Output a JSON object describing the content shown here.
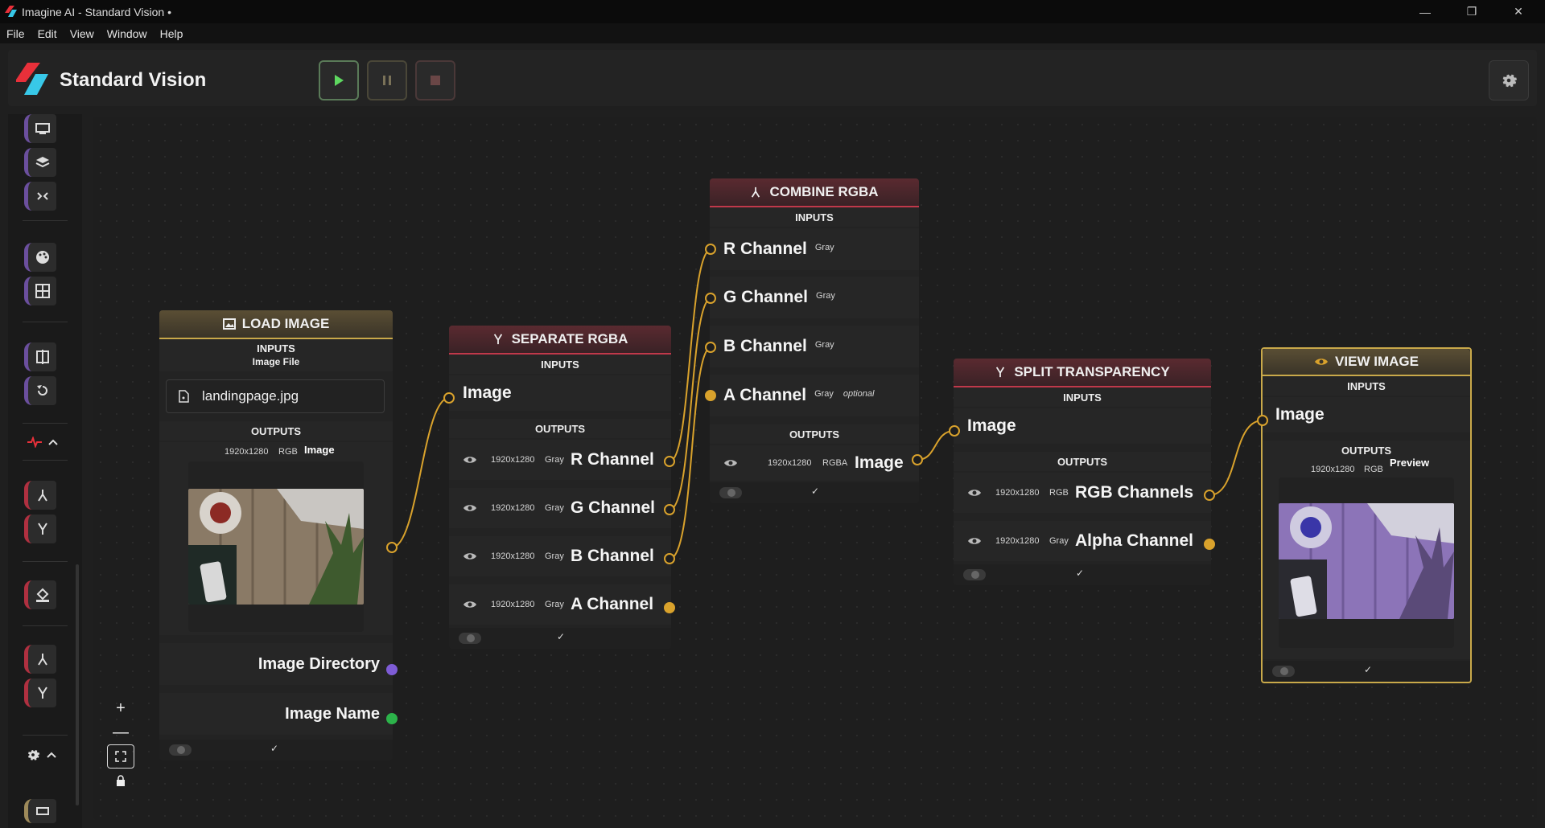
{
  "window": {
    "title": "Imagine AI - Standard Vision •",
    "minimize": "—",
    "restore": "❐",
    "close": "✕"
  },
  "menu": [
    "File",
    "Edit",
    "View",
    "Window",
    "Help"
  ],
  "header": {
    "brand": "Standard Vision"
  },
  "colors": {
    "gold": "#c9a94a",
    "red": "#c0384a",
    "port": "#d9a22c",
    "purple": "#7e5cd6",
    "green": "#2cb34a"
  },
  "nodes": {
    "load_image": {
      "title": "LOAD IMAGE",
      "inputs_label": "INPUTS",
      "input_name": "Image File",
      "file_value": "landingpage.jpg",
      "outputs_label": "OUTPUTS",
      "out_size": "1920x1280",
      "out_mode": "RGB",
      "out_name": "Image",
      "dir_label": "Image Directory",
      "name_label": "Image Name"
    },
    "separate_rgba": {
      "title": "SEPARATE RGBA",
      "inputs_label": "INPUTS",
      "input_image": "Image",
      "outputs_label": "OUTPUTS",
      "outputs": [
        {
          "size": "1920x1280",
          "mode": "Gray",
          "name": "R Channel"
        },
        {
          "size": "1920x1280",
          "mode": "Gray",
          "name": "G Channel"
        },
        {
          "size": "1920x1280",
          "mode": "Gray",
          "name": "B Channel"
        },
        {
          "size": "1920x1280",
          "mode": "Gray",
          "name": "A Channel"
        }
      ]
    },
    "combine_rgba": {
      "title": "COMBINE RGBA",
      "inputs_label": "INPUTS",
      "inputs": [
        {
          "name": "R Channel",
          "mode": "Gray",
          "opt": ""
        },
        {
          "name": "G Channel",
          "mode": "Gray",
          "opt": ""
        },
        {
          "name": "B Channel",
          "mode": "Gray",
          "opt": ""
        },
        {
          "name": "A Channel",
          "mode": "Gray",
          "opt": "optional"
        }
      ],
      "outputs_label": "OUTPUTS",
      "out_size": "1920x1280",
      "out_mode": "RGBA",
      "out_name": "Image"
    },
    "split_transparency": {
      "title": "SPLIT TRANSPARENCY",
      "inputs_label": "INPUTS",
      "input_image": "Image",
      "outputs_label": "OUTPUTS",
      "outputs": [
        {
          "size": "1920x1280",
          "mode": "RGB",
          "name": "RGB Channels"
        },
        {
          "size": "1920x1280",
          "mode": "Gray",
          "name": "Alpha Channel"
        }
      ]
    },
    "view_image": {
      "title": "VIEW IMAGE",
      "inputs_label": "INPUTS",
      "input_image": "Image",
      "outputs_label": "OUTPUTS",
      "out_size": "1920x1280",
      "out_mode": "RGB",
      "out_name": "Preview"
    }
  },
  "icons": [
    "app-logo-icon",
    "play-icon",
    "pause-icon",
    "stop-icon",
    "gear-icon",
    "monitor-icon",
    "layers-icon",
    "split-icon",
    "palette-icon",
    "grid-icon",
    "compare-icon",
    "rotate-icon",
    "merge-icon",
    "fork-icon",
    "fill-icon",
    "chevron-up-icon",
    "eye-icon",
    "file-icon",
    "image-icon",
    "zoom-in-icon",
    "zoom-out-icon",
    "fit-icon",
    "lock-icon"
  ]
}
